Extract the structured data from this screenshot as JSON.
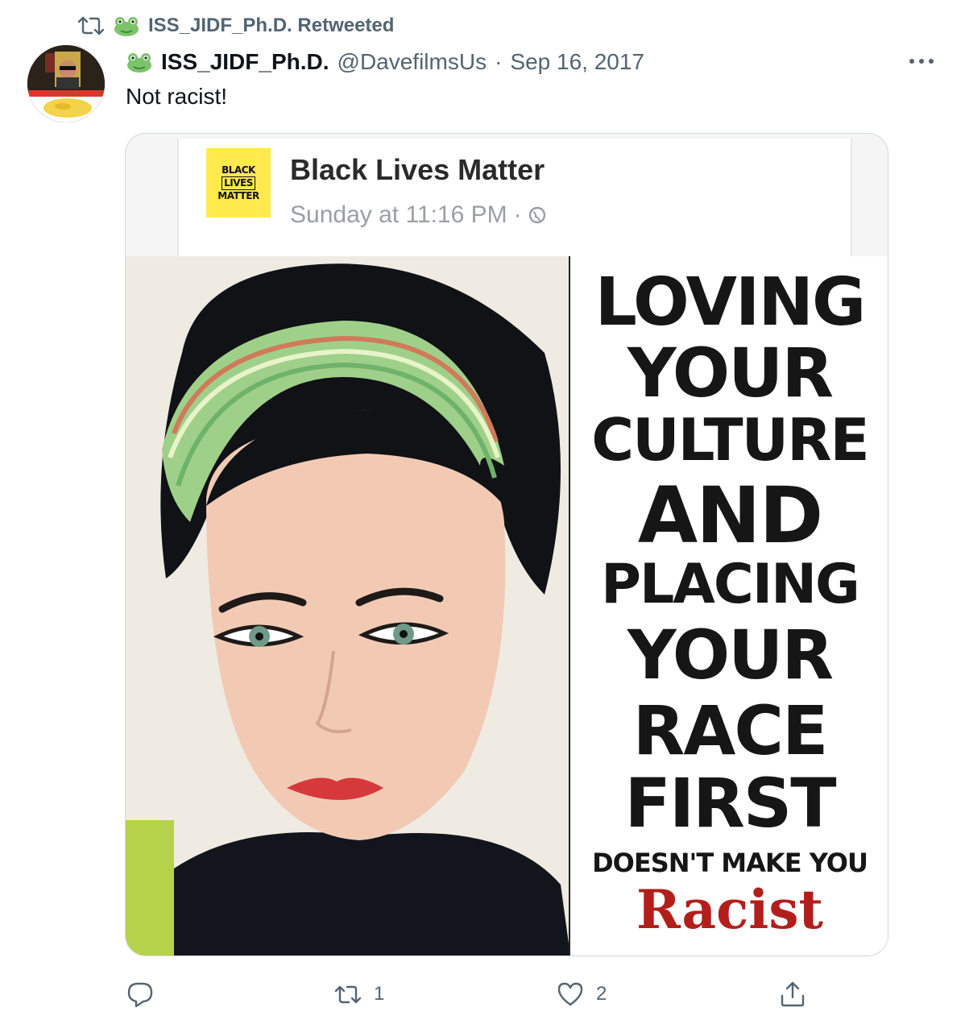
{
  "retweet_banner": {
    "text": "ISS_JIDF_Ph.D. Retweeted"
  },
  "tweet": {
    "display_name": "ISS_JIDF_Ph.D.",
    "handle": "@DavefilmsUs",
    "separator": "·",
    "date": "Sep 16, 2017",
    "text": "Not racist!",
    "icons": {
      "retweet_banner": "retweet-icon",
      "name_emoji": "frog-icon",
      "more": "more-icon"
    }
  },
  "media": {
    "fb_post": {
      "logo_lines": [
        "BLACK",
        "LIVES",
        "MATTER"
      ],
      "page_name": "Black Lives Matter",
      "timestamp": "Sunday at 11:16 PM",
      "separator": "·",
      "privacy_icon": "globe-icon"
    },
    "poster_lines": [
      "LOVING",
      "YOUR",
      "CULTURE",
      "AND",
      "PLACING",
      "YOUR",
      "RACE",
      "FIRST",
      "DOESN'T MAKE YOU",
      "Racist"
    ]
  },
  "actions": {
    "reply": {
      "icon": "reply-icon",
      "count": ""
    },
    "retweet": {
      "icon": "retweet-icon",
      "count": "1"
    },
    "like": {
      "icon": "heart-icon",
      "count": "2"
    },
    "share": {
      "icon": "share-icon"
    }
  },
  "colors": {
    "text_primary": "#0f1419",
    "text_secondary": "#536471",
    "border": "#cfd9de",
    "racist_red": "#b21f1b",
    "blm_yellow": "#ffe94d"
  }
}
